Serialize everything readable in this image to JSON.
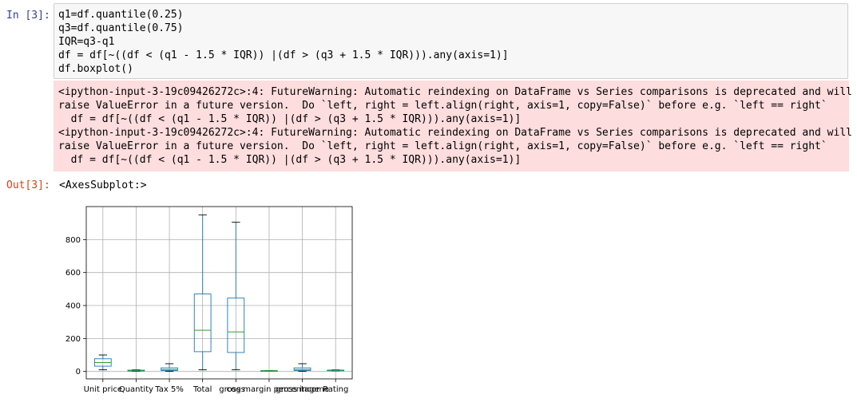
{
  "cell": {
    "in_prompt": "In [3]:",
    "out_prompt": "Out[3]:",
    "code_lines": [
      "q1=df.quantile(0.25)",
      "q3=df.quantile(0.75)",
      "IQR=q3-q1",
      "df = df[~((df < (q1 - 1.5 * IQR)) |(df > (q3 + 1.5 * IQR))).any(axis=1)]",
      "df.boxplot()"
    ],
    "warning_lines": [
      "<ipython-input-3-19c09426272c>:4: FutureWarning: Automatic reindexing on DataFrame vs Series comparisons is deprecated and will",
      "raise ValueError in a future version.  Do `left, right = left.align(right, axis=1, copy=False)` before e.g. `left == right`",
      "  df = df[~((df < (q1 - 1.5 * IQR)) |(df > (q3 + 1.5 * IQR))).any(axis=1)]",
      "<ipython-input-3-19c09426272c>:4: FutureWarning: Automatic reindexing on DataFrame vs Series comparisons is deprecated and will",
      "raise ValueError in a future version.  Do `left, right = left.align(right, axis=1, copy=False)` before e.g. `left == right`",
      "  df = df[~((df < (q1 - 1.5 * IQR)) |(df > (q3 + 1.5 * IQR))).any(axis=1)]"
    ],
    "output_text": "<AxesSubplot:>"
  },
  "chart_data": {
    "type": "boxplot",
    "categories": [
      "Unit price",
      "Quantity",
      "Tax 5%",
      "Total",
      "cogs",
      "gross margin percentage",
      "gross income",
      "Rating"
    ],
    "boxes": [
      {
        "name": "Unit price",
        "whislo": 10,
        "q1": 32,
        "med": 54,
        "q3": 77,
        "whishi": 100
      },
      {
        "name": "Quantity",
        "whislo": 1,
        "q1": 3,
        "med": 5,
        "q3": 8,
        "whishi": 10
      },
      {
        "name": "Tax 5%",
        "whislo": 0.5,
        "q1": 6,
        "med": 12,
        "q3": 22,
        "whishi": 47
      },
      {
        "name": "Total",
        "whislo": 10,
        "q1": 120,
        "med": 250,
        "q3": 470,
        "whishi": 950
      },
      {
        "name": "cogs",
        "whislo": 10,
        "q1": 115,
        "med": 240,
        "q3": 445,
        "whishi": 905
      },
      {
        "name": "gross margin percentage",
        "whislo": 4.76,
        "q1": 4.76,
        "med": 4.76,
        "q3": 4.76,
        "whishi": 4.76
      },
      {
        "name": "gross income",
        "whislo": 0.5,
        "q1": 6,
        "med": 12,
        "q3": 22,
        "whishi": 47
      },
      {
        "name": "Rating",
        "whislo": 4,
        "q1": 5.5,
        "med": 7,
        "q3": 8.5,
        "whishi": 10
      }
    ],
    "yticks": [
      0,
      200,
      400,
      600,
      800
    ],
    "ylim": [
      -45,
      1000
    ],
    "grid": true,
    "colors": {
      "box": "#1f77b4",
      "median": "#2ca02c",
      "whisker": "#000000",
      "grid": "#b0b0b0"
    }
  }
}
